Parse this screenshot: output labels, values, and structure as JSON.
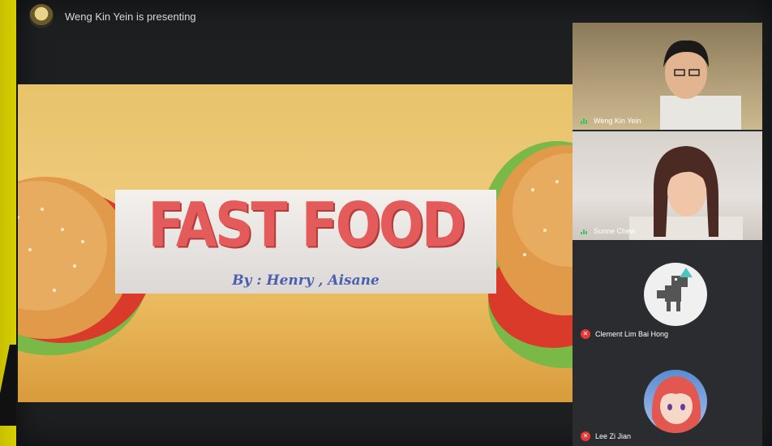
{
  "presenter": {
    "text": "Weng Kin Yein is presenting",
    "avatar_icon": "user-avatar-icon"
  },
  "slide": {
    "title": "FAST FOOD",
    "subtitle": "By : Henry , Aisane"
  },
  "participants": [
    {
      "name": "Weng Kin Yein",
      "mic": "on"
    },
    {
      "name": "Sunne Chew",
      "mic": "on"
    },
    {
      "name": "Clement Lim Bai Hong",
      "mic": "off",
      "avatar_icon": "dino-icon"
    },
    {
      "name": "Lee Zi Jian",
      "mic": "off",
      "avatar_icon": "anime-avatar-icon"
    }
  ],
  "colors": {
    "frame": "#d4cc00",
    "slide_title": "#e45b5b",
    "slide_subtitle": "#4b5fb0",
    "mic_on": "#39c46a",
    "mic_off": "#e53935"
  }
}
